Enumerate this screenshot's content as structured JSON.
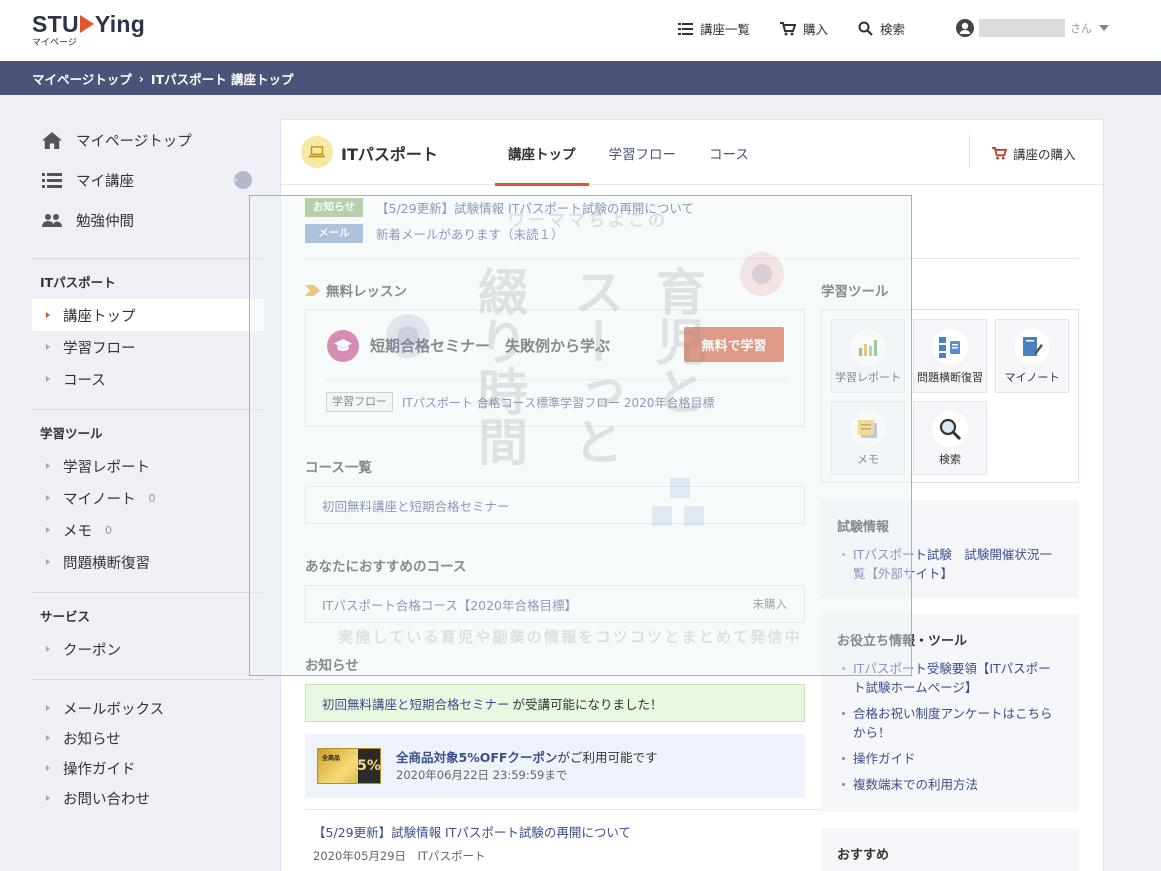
{
  "header": {
    "logo_text_pre": "STU",
    "logo_text_post": "Ying",
    "logo_sub": "マイページ",
    "nav": [
      {
        "label": "講座一覧",
        "icon": "list-icon"
      },
      {
        "label": "購入",
        "icon": "cart-icon"
      },
      {
        "label": "検索",
        "icon": "search-icon"
      }
    ],
    "user_suffix": "さん"
  },
  "breadcrumb": {
    "home": "マイページトップ",
    "sep": "›",
    "current": "ITパスポート 講座トップ"
  },
  "sidebar": {
    "top_items": [
      {
        "label": "マイページトップ",
        "icon": "home-icon"
      },
      {
        "label": "マイ講座",
        "icon": "list-icon"
      },
      {
        "label": "勉強仲間",
        "icon": "users-icon"
      }
    ],
    "course_section": {
      "title": "ITパスポート",
      "items": [
        "講座トップ",
        "学習フロー",
        "コース"
      ]
    },
    "tools_section": {
      "title": "学習ツール",
      "items": [
        {
          "label": "学習レポート",
          "count": ""
        },
        {
          "label": "マイノート",
          "count": "0"
        },
        {
          "label": "メモ",
          "count": "0"
        },
        {
          "label": "問題横断復習",
          "count": ""
        }
      ]
    },
    "service_section": {
      "title": "サービス",
      "items": [
        "クーポン"
      ]
    },
    "bottom_items": [
      "メールボックス",
      "お知らせ",
      "操作ガイド",
      "お問い合わせ"
    ]
  },
  "main": {
    "course_name": "ITパスポート",
    "tabs": [
      "講座トップ",
      "学習フロー",
      "コース"
    ],
    "buy_label": "講座の購入",
    "notices": [
      {
        "tag": "お知らせ",
        "text": "【5/29更新】試験情報 ITパスポート試験の再開について"
      },
      {
        "tag": "メール",
        "text": "新着メールがあります（未読１）"
      }
    ],
    "free_lesson": {
      "section_title": "無料レッスン",
      "name": "短期合格セミナー　失敗例から学ぶ",
      "button": "無料で学習",
      "flow_tag": "学習フロー",
      "flow_link": "ITパスポート 合格コース標準学習フロー 2020年合格目標"
    },
    "course_list": {
      "title": "コース一覧",
      "item": "初回無料講座と短期合格セミナー"
    },
    "recommend": {
      "title": "あなたにおすすめのコース",
      "item": "ITパスポート合格コース【2020年合格目標】",
      "status": "未購入"
    },
    "news": {
      "title": "お知らせ",
      "success_link": "初回無料講座と短期合格セミナー",
      "success_text": "が受講可能になりました！",
      "coupon_title_bold": "全商品対象5%OFFクーポン",
      "coupon_title_rest": "がご利用可能です",
      "coupon_date": "2020年06月22日 23:59:59まで",
      "coupon_img_left": "全商品",
      "coupon_img_right": "5%",
      "item_link": "【5/29更新】試験情報 ITパスポート試験の再開について",
      "item_meta": "2020年05月29日　ITパスポート"
    }
  },
  "right": {
    "tools_title": "学習ツール",
    "tools": [
      {
        "label": "学習レポート",
        "icon": "report-chart-icon"
      },
      {
        "label": "問題横断復習",
        "icon": "review-icon"
      },
      {
        "label": "マイノート",
        "icon": "note-icon"
      },
      {
        "label": "メモ",
        "icon": "memo-icon"
      },
      {
        "label": "検索",
        "icon": "search-icon"
      }
    ],
    "exam_info": {
      "title": "試験情報",
      "items": [
        "ITパスポート試験　試験開催状況一覧【外部サイト】"
      ]
    },
    "useful_info": {
      "title": "お役立ち情報・ツール",
      "items": [
        "ITパスポート受験要領【ITパスポート試験ホームページ】",
        "合格お祝い制度アンケートはこちらから！",
        "操作ガイド",
        "複数端末での利用方法"
      ]
    },
    "recommend_title": "おすすめ"
  },
  "watermark": {
    "small_top": "ワーママちよこの",
    "col1": "綴り時間",
    "col2": "スーっと",
    "col3": "育児と",
    "bottom": "実施している育児や副業の情報をコツコツとまとめて発信中"
  },
  "colors": {
    "accent": "#e2542b",
    "navy": "#4a5478",
    "link": "#3d4e8a"
  }
}
